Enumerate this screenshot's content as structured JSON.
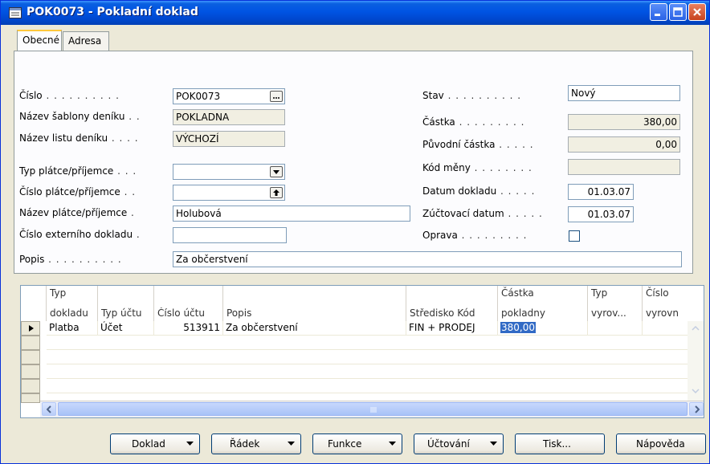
{
  "window": {
    "title": "POK0073 - Pokladní doklad"
  },
  "tabs": [
    {
      "label": "Obecné"
    },
    {
      "label": "Adresa"
    }
  ],
  "general": {
    "cislo": {
      "label": "Číslo",
      "value": "POK0073"
    },
    "nazev_sablony": {
      "label": "Název šablony deníku",
      "value": "POKLADNA"
    },
    "nazev_listu": {
      "label": "Název listu deníku",
      "value": "VÝCHOZÍ"
    },
    "typ_platce": {
      "label": "Typ plátce/příjemce",
      "value": ""
    },
    "cislo_platce": {
      "label": "Číslo plátce/příjemce",
      "value": ""
    },
    "nazev_platce": {
      "label": "Název plátce/příjemce",
      "value": "Holubová"
    },
    "cislo_ext": {
      "label": "Číslo externího dokladu",
      "value": ""
    },
    "popis": {
      "label": "Popis",
      "value": "Za občerstvení"
    },
    "stav": {
      "label": "Stav",
      "value": "Nový"
    },
    "castka": {
      "label": "Částka",
      "value": "380,00"
    },
    "puvodni_castka": {
      "label": "Původní částka",
      "value": "0,00"
    },
    "kod_meny": {
      "label": "Kód měny",
      "value": ""
    },
    "datum_dokladu": {
      "label": "Datum dokladu",
      "value": "01.03.07"
    },
    "zuctovaci_datum": {
      "label": "Zúčtovací datum",
      "value": "01.03.07"
    },
    "oprava": {
      "label": "Oprava",
      "checked": false
    }
  },
  "lines": {
    "headers": [
      {
        "top": "Typ",
        "bottom": "dokladu"
      },
      {
        "top": "",
        "bottom": "Typ účtu"
      },
      {
        "top": "",
        "bottom": "Číslo účtu"
      },
      {
        "top": "",
        "bottom": "Popis"
      },
      {
        "top": "",
        "bottom": "Středisko Kód"
      },
      {
        "top": "Částka",
        "bottom": "pokladny"
      },
      {
        "top": "Typ",
        "bottom": "vyrov..."
      },
      {
        "top": "Číslo",
        "bottom": "vyrovn"
      }
    ],
    "rows": [
      {
        "cells": [
          "Platba",
          "Účet",
          "513911",
          "Za občerstvení",
          "FIN + PRODEJ",
          "380,00",
          "",
          ""
        ]
      }
    ]
  },
  "buttons": {
    "doklad": "Doklad",
    "radek": "Řádek",
    "funkce": "Funkce",
    "uctovani": "Účtování",
    "tisk": "Tisk...",
    "napoveda": "Nápověda"
  },
  "colors": {
    "titlebar": "#0054e3",
    "selection": "#316ac5",
    "tab_highlight": "#ffc73c"
  },
  "icons": [
    "form-icon",
    "minimize-icon",
    "maximize-icon",
    "close-icon",
    "assist-edit-icon",
    "dropdown-icon",
    "lookup-icon",
    "row-pointer-icon",
    "scroll-up-icon",
    "scroll-down-icon",
    "scroll-left-icon",
    "scroll-right-icon"
  ]
}
